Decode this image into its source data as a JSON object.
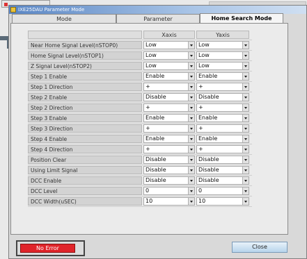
{
  "window": {
    "title": "IXE25DAU Parameter Mode"
  },
  "tabs": [
    {
      "label": "Mode"
    },
    {
      "label": "Parameter"
    },
    {
      "label": "Home Search Mode"
    }
  ],
  "table": {
    "col_x": "Xaxis",
    "col_y": "Yaxis",
    "rows": [
      {
        "label": "Near Home Signal Level(nSTOP0)",
        "x": "Low",
        "y": "Low"
      },
      {
        "label": "Home Signal Level(nSTOP1)",
        "x": "Low",
        "y": "Low"
      },
      {
        "label": "Z Signal Level(nSTOP2)",
        "x": "Low",
        "y": "Low"
      },
      {
        "label": "Step 1 Enable",
        "x": "Enable",
        "y": "Enable"
      },
      {
        "label": "Step 1 Direction",
        "x": "+",
        "y": "+"
      },
      {
        "label": "Step 2 Enable",
        "x": "Disable",
        "y": "Disable"
      },
      {
        "label": "Step 2 Direction",
        "x": "+",
        "y": "+"
      },
      {
        "label": "Step 3 Enable",
        "x": "Enable",
        "y": "Enable"
      },
      {
        "label": "Step 3 Direction",
        "x": "+",
        "y": "+"
      },
      {
        "label": "Step 4 Enable",
        "x": "Enable",
        "y": "Enable"
      },
      {
        "label": "Step 4 Direction",
        "x": "+",
        "y": "+"
      },
      {
        "label": "Position Clear",
        "x": "Disable",
        "y": "Disable"
      },
      {
        "label": "Using Limit Signal",
        "x": "Disable",
        "y": "Disable"
      },
      {
        "label": "DCC Enable",
        "x": "Disable",
        "y": "Disable"
      },
      {
        "label": "DCC Level",
        "x": "0",
        "y": "0"
      },
      {
        "label": "DCC Width(uSEC)",
        "x": "10",
        "y": "10"
      }
    ]
  },
  "footer": {
    "error_label": "No Error",
    "close_label": "Close"
  },
  "colors": {
    "error": "#e0242a",
    "titlebar": "#5a86c4"
  },
  "icons": {
    "app": "app-icon",
    "arrow": "pointer-arrow-icon",
    "dropdown": "chevron-down-icon"
  }
}
